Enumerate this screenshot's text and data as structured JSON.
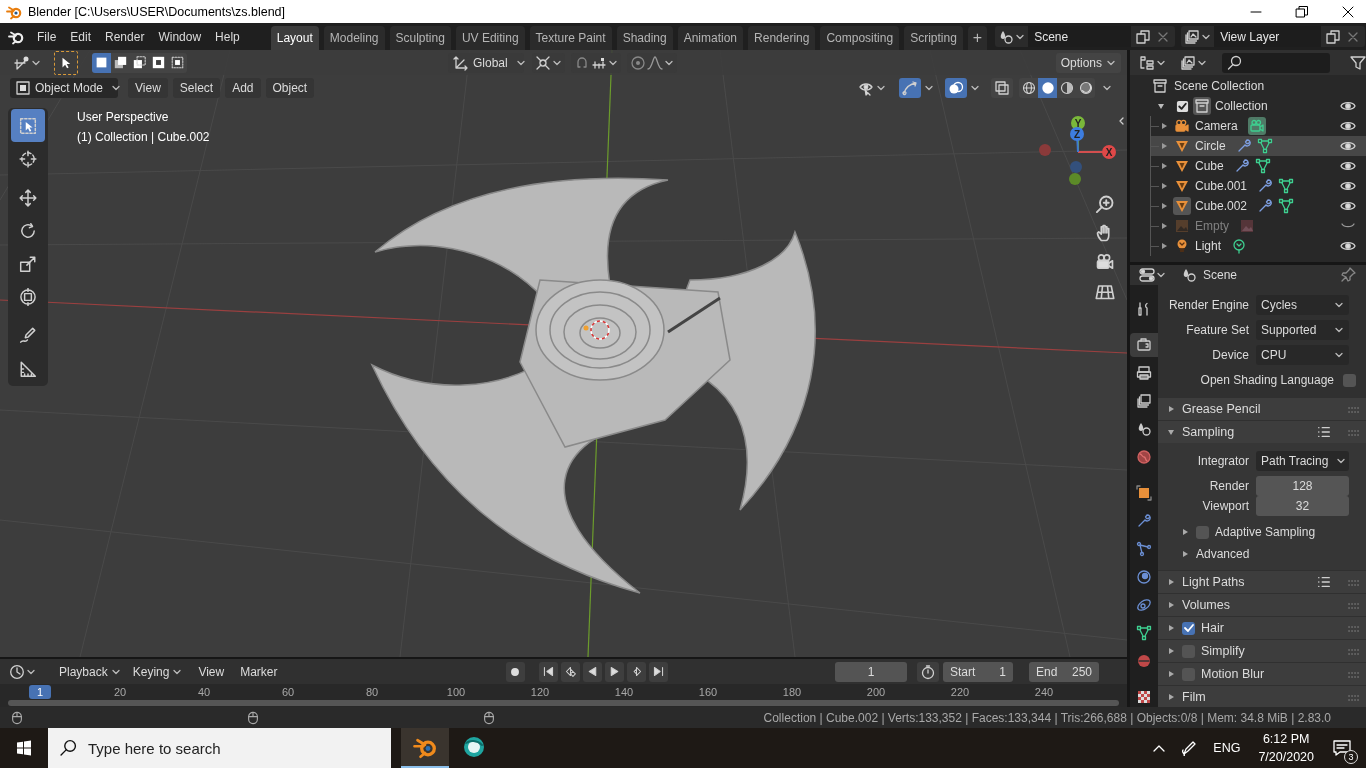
{
  "window": {
    "title": "Blender [C:\\Users\\USER\\Documents\\zs.blend]"
  },
  "menu": [
    "File",
    "Edit",
    "Render",
    "Window",
    "Help"
  ],
  "workspaces": [
    {
      "label": "Layout",
      "selected": true
    },
    {
      "label": "Modeling",
      "selected": false
    },
    {
      "label": "Sculpting",
      "selected": false
    },
    {
      "label": "UV Editing",
      "selected": false
    },
    {
      "label": "Texture Paint",
      "selected": false
    },
    {
      "label": "Shading",
      "selected": false
    },
    {
      "label": "Animation",
      "selected": false
    },
    {
      "label": "Rendering",
      "selected": false
    },
    {
      "label": "Compositing",
      "selected": false
    },
    {
      "label": "Scripting",
      "selected": false
    }
  ],
  "add_workspace": "+",
  "scene": "Scene",
  "view_layer": "View Layer",
  "viewport": {
    "select_modes": [
      {
        "kind": "set",
        "selected": true
      },
      {
        "kind": "extend",
        "selected": false
      },
      {
        "kind": "subtract",
        "selected": false
      },
      {
        "kind": "invert",
        "selected": false
      },
      {
        "kind": "intersect",
        "selected": false
      }
    ],
    "orientation": "Global",
    "options": "Options",
    "mode": "Object Mode",
    "menus": [
      "View",
      "Select",
      "Add",
      "Object"
    ],
    "toggles": [
      {
        "kind": "gizmo",
        "on": true
      },
      {
        "kind": "overlays",
        "on": true
      },
      {
        "kind": "xray",
        "on": false
      }
    ],
    "shading": [
      {
        "kind": "wireframe",
        "selected": false
      },
      {
        "kind": "solid",
        "selected": true
      },
      {
        "kind": "material",
        "selected": false
      },
      {
        "kind": "rendered",
        "selected": false
      }
    ],
    "tools": [
      {
        "kind": "select",
        "selected": true
      },
      {
        "kind": "cursor",
        "selected": false
      },
      {
        "kind": "move",
        "selected": false
      },
      {
        "kind": "rotate",
        "selected": false
      },
      {
        "kind": "scale",
        "selected": false
      },
      {
        "kind": "transform",
        "selected": false
      },
      {
        "kind": "annotate",
        "selected": false
      },
      {
        "kind": "measure",
        "selected": false
      }
    ],
    "overlay_text": [
      "User Perspective",
      "(1) Collection | Cube.002"
    ],
    "gizmo_axes": [
      "X",
      "Y",
      "Z"
    ]
  },
  "timeline": {
    "menus": [
      {
        "label": "Playback",
        "kind": "dropdown"
      },
      {
        "label": "Keying",
        "kind": "dropdown"
      },
      {
        "label": "View",
        "kind": "menu"
      },
      {
        "label": "Marker",
        "kind": "menu"
      }
    ],
    "current_frame": "1",
    "start": {
      "label": "Start",
      "value": "1"
    },
    "end": {
      "label": "End",
      "value": "250"
    },
    "ruler_current": "1",
    "ruler": [
      "20",
      "40",
      "60",
      "80",
      "100",
      "120",
      "140",
      "160",
      "180",
      "200",
      "220",
      "240"
    ]
  },
  "outliner": {
    "root": "Scene Collection",
    "collection": {
      "name": "Collection",
      "checked": true,
      "expanded": true,
      "visible": true,
      "children": [
        {
          "name": "Camera",
          "kind": "camera",
          "selected": false,
          "active": false,
          "visible": true,
          "expanded": false
        },
        {
          "name": "Circle",
          "kind": "mesh",
          "selected": true,
          "active": false,
          "visible": true,
          "expanded": false
        },
        {
          "name": "Cube",
          "kind": "mesh",
          "selected": false,
          "active": false,
          "visible": true,
          "expanded": false
        },
        {
          "name": "Cube.001",
          "kind": "mesh",
          "selected": false,
          "active": false,
          "visible": true,
          "expanded": false
        },
        {
          "name": "Cube.002",
          "kind": "mesh",
          "selected": false,
          "active": true,
          "visible": true,
          "expanded": false
        },
        {
          "name": "Empty",
          "kind": "empty",
          "selected": false,
          "active": false,
          "visible": false,
          "expanded": false
        },
        {
          "name": "Light",
          "kind": "light",
          "selected": false,
          "active": false,
          "visible": true,
          "expanded": false
        }
      ]
    }
  },
  "properties": {
    "context": "Scene",
    "tabs": [
      {
        "kind": "tool",
        "selected": false
      },
      {
        "kind": "render",
        "selected": true
      },
      {
        "kind": "output",
        "selected": false
      },
      {
        "kind": "view_layer",
        "selected": false
      },
      {
        "kind": "scene",
        "selected": false
      },
      {
        "kind": "world",
        "selected": false
      },
      {
        "kind": "object",
        "selected": false
      },
      {
        "kind": "modifiers",
        "selected": false
      },
      {
        "kind": "particles",
        "selected": false
      },
      {
        "kind": "physics",
        "selected": false
      },
      {
        "kind": "constraints",
        "selected": false
      },
      {
        "kind": "data",
        "selected": false
      },
      {
        "kind": "material",
        "selected": false
      },
      {
        "kind": "texture",
        "selected": false
      }
    ],
    "fields": [
      {
        "kind": "dropdown",
        "label": "Render Engine",
        "value": "Cycles"
      },
      {
        "kind": "dropdown",
        "label": "Feature Set",
        "value": "Supported"
      },
      {
        "kind": "dropdown",
        "label": "Device",
        "value": "CPU"
      },
      {
        "kind": "checkbox",
        "label": "Open Shading Language",
        "checked": false
      }
    ],
    "panels": [
      {
        "label": "Grease Pencil",
        "expanded": false,
        "presets": false
      },
      {
        "label": "Sampling",
        "expanded": true,
        "presets": true,
        "fields": [
          {
            "kind": "dropdown",
            "label": "Integrator",
            "value": "Path Tracing"
          },
          {
            "kind": "number",
            "label": "Render",
            "value": "128"
          },
          {
            "kind": "number",
            "label": "Viewport",
            "value": "32"
          }
        ],
        "subpanels": [
          {
            "label": "Adaptive Sampling",
            "expanded": false,
            "toggle": {
              "checked": false
            }
          },
          {
            "label": "Advanced",
            "expanded": false
          }
        ]
      },
      {
        "label": "Light Paths",
        "expanded": false,
        "presets": true
      },
      {
        "label": "Volumes",
        "expanded": false,
        "presets": false
      },
      {
        "label": "Hair",
        "expanded": false,
        "presets": false,
        "toggle": {
          "checked": true
        }
      },
      {
        "label": "Simplify",
        "expanded": false,
        "presets": false,
        "toggle": {
          "checked": false
        }
      },
      {
        "label": "Motion Blur",
        "expanded": false,
        "presets": false,
        "toggle": {
          "checked": false
        }
      },
      {
        "label": "Film",
        "expanded": false,
        "presets": false
      }
    ]
  },
  "status_bar": {
    "text": "Collection | Cube.002 | Verts:133,352 | Faces:133,344 | Tris:266,688 | Objects:0/8 | Mem: 34.8 MiB | 2.83.0"
  },
  "taskbar": {
    "search_placeholder": "Type here to search",
    "apps": [
      {
        "kind": "blender",
        "selected": true
      },
      {
        "kind": "browser",
        "selected": false
      }
    ],
    "language": "ENG",
    "time": "6:12 PM",
    "date": "7/20/2020",
    "notifications": "3"
  }
}
